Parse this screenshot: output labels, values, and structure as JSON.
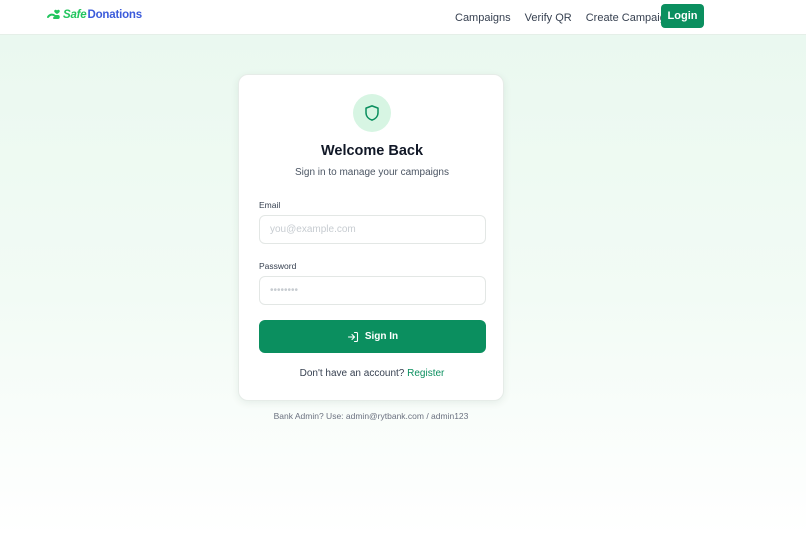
{
  "brand": {
    "part1": "Safe",
    "part2": "Donations",
    "icon": "hand-heart-icon",
    "colors": {
      "part1": "#22c55e",
      "part2": "#3b5bdb"
    }
  },
  "nav": {
    "links": [
      {
        "label": "Campaigns"
      },
      {
        "label": "Verify QR"
      },
      {
        "label": "Create Campaign"
      }
    ],
    "login_label": "Login"
  },
  "card": {
    "icon": "shield-icon",
    "title": "Welcome Back",
    "subtitle": "Sign in to manage your campaigns",
    "email": {
      "label": "Email",
      "placeholder": "you@example.com",
      "value": ""
    },
    "password": {
      "label": "Password",
      "placeholder": "••••••••",
      "value": ""
    },
    "submit_label": "Sign In",
    "submit_icon": "log-in-icon",
    "register_prompt": "Don't have an account?",
    "register_link": "Register"
  },
  "hint": "Bank Admin? Use: admin@rytbank.com / admin123",
  "colors": {
    "accent": "#0b8f5f",
    "accent_light": "#d7f5e3"
  }
}
